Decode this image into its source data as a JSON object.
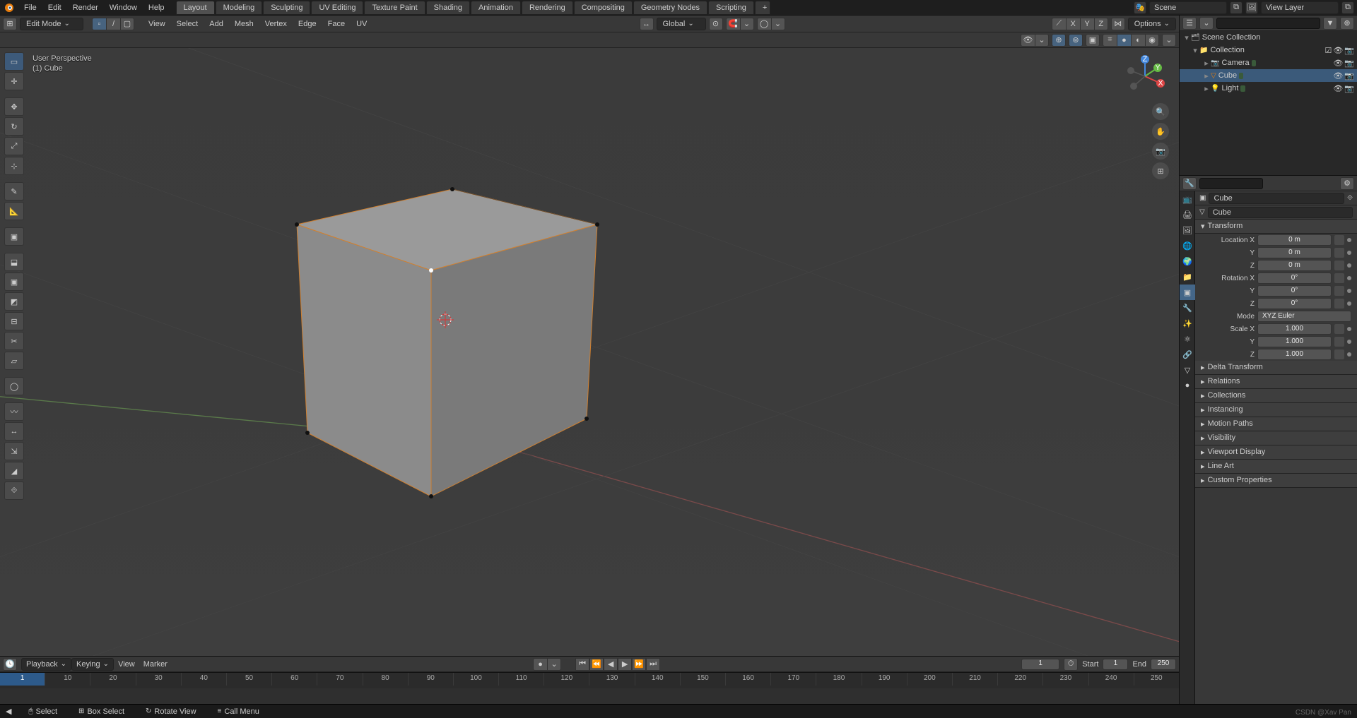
{
  "topmenu": [
    "File",
    "Edit",
    "Render",
    "Window",
    "Help"
  ],
  "workspaces": [
    "Layout",
    "Modeling",
    "Sculpting",
    "UV Editing",
    "Texture Paint",
    "Shading",
    "Animation",
    "Rendering",
    "Compositing",
    "Geometry Nodes",
    "Scripting"
  ],
  "active_workspace": "Layout",
  "scene": "Scene",
  "viewlayer": "View Layer",
  "mode": "Edit Mode",
  "view3d_menus": [
    "View",
    "Select",
    "Add",
    "Mesh",
    "Vertex",
    "Edge",
    "Face",
    "UV"
  ],
  "orientation": "Global",
  "options_label": "Options",
  "axes": [
    "X",
    "Y",
    "Z"
  ],
  "vp_info_line1": "User Perspective",
  "vp_info_line2": "(1) Cube",
  "outliner": {
    "root": "Scene Collection",
    "coll": "Collection",
    "items": [
      "Camera",
      "Cube",
      "Light"
    ],
    "selected": "Cube"
  },
  "props_bc1": "Cube",
  "props_bc2": "Cube",
  "transform_header": "Transform",
  "fields": [
    {
      "label": "Location X",
      "val": "0 m"
    },
    {
      "label": "Y",
      "val": "0 m"
    },
    {
      "label": "Z",
      "val": "0 m"
    },
    {
      "label": "Rotation X",
      "val": "0°"
    },
    {
      "label": "Y",
      "val": "0°"
    },
    {
      "label": "Z",
      "val": "0°"
    }
  ],
  "mode_label": "Mode",
  "mode_val": "XYZ Euler",
  "scale_fields": [
    {
      "label": "Scale X",
      "val": "1.000"
    },
    {
      "label": "Y",
      "val": "1.000"
    },
    {
      "label": "Z",
      "val": "1.000"
    }
  ],
  "collapsed_panels": [
    "Delta Transform",
    "Relations",
    "Collections",
    "Instancing",
    "Motion Paths",
    "Visibility",
    "Viewport Display",
    "Line Art",
    "Custom Properties"
  ],
  "timeline": {
    "menus": [
      "Playback",
      "Keying",
      "View",
      "Marker"
    ],
    "current": "1",
    "start_lbl": "Start",
    "start": "1",
    "end_lbl": "End",
    "end": "250",
    "ticks": [
      "1",
      "10",
      "20",
      "30",
      "40",
      "50",
      "60",
      "70",
      "80",
      "90",
      "100",
      "110",
      "120",
      "130",
      "140",
      "150",
      "160",
      "170",
      "180",
      "190",
      "200",
      "210",
      "220",
      "230",
      "240",
      "250"
    ]
  },
  "status": [
    {
      "ic": "🖱",
      "t": "Select"
    },
    {
      "ic": "⊞",
      "t": "Box Select"
    },
    {
      "ic": "↻",
      "t": "Rotate View"
    },
    {
      "ic": "≡",
      "t": "Call Menu"
    }
  ],
  "watermark": "CSDN @Xav Pan"
}
